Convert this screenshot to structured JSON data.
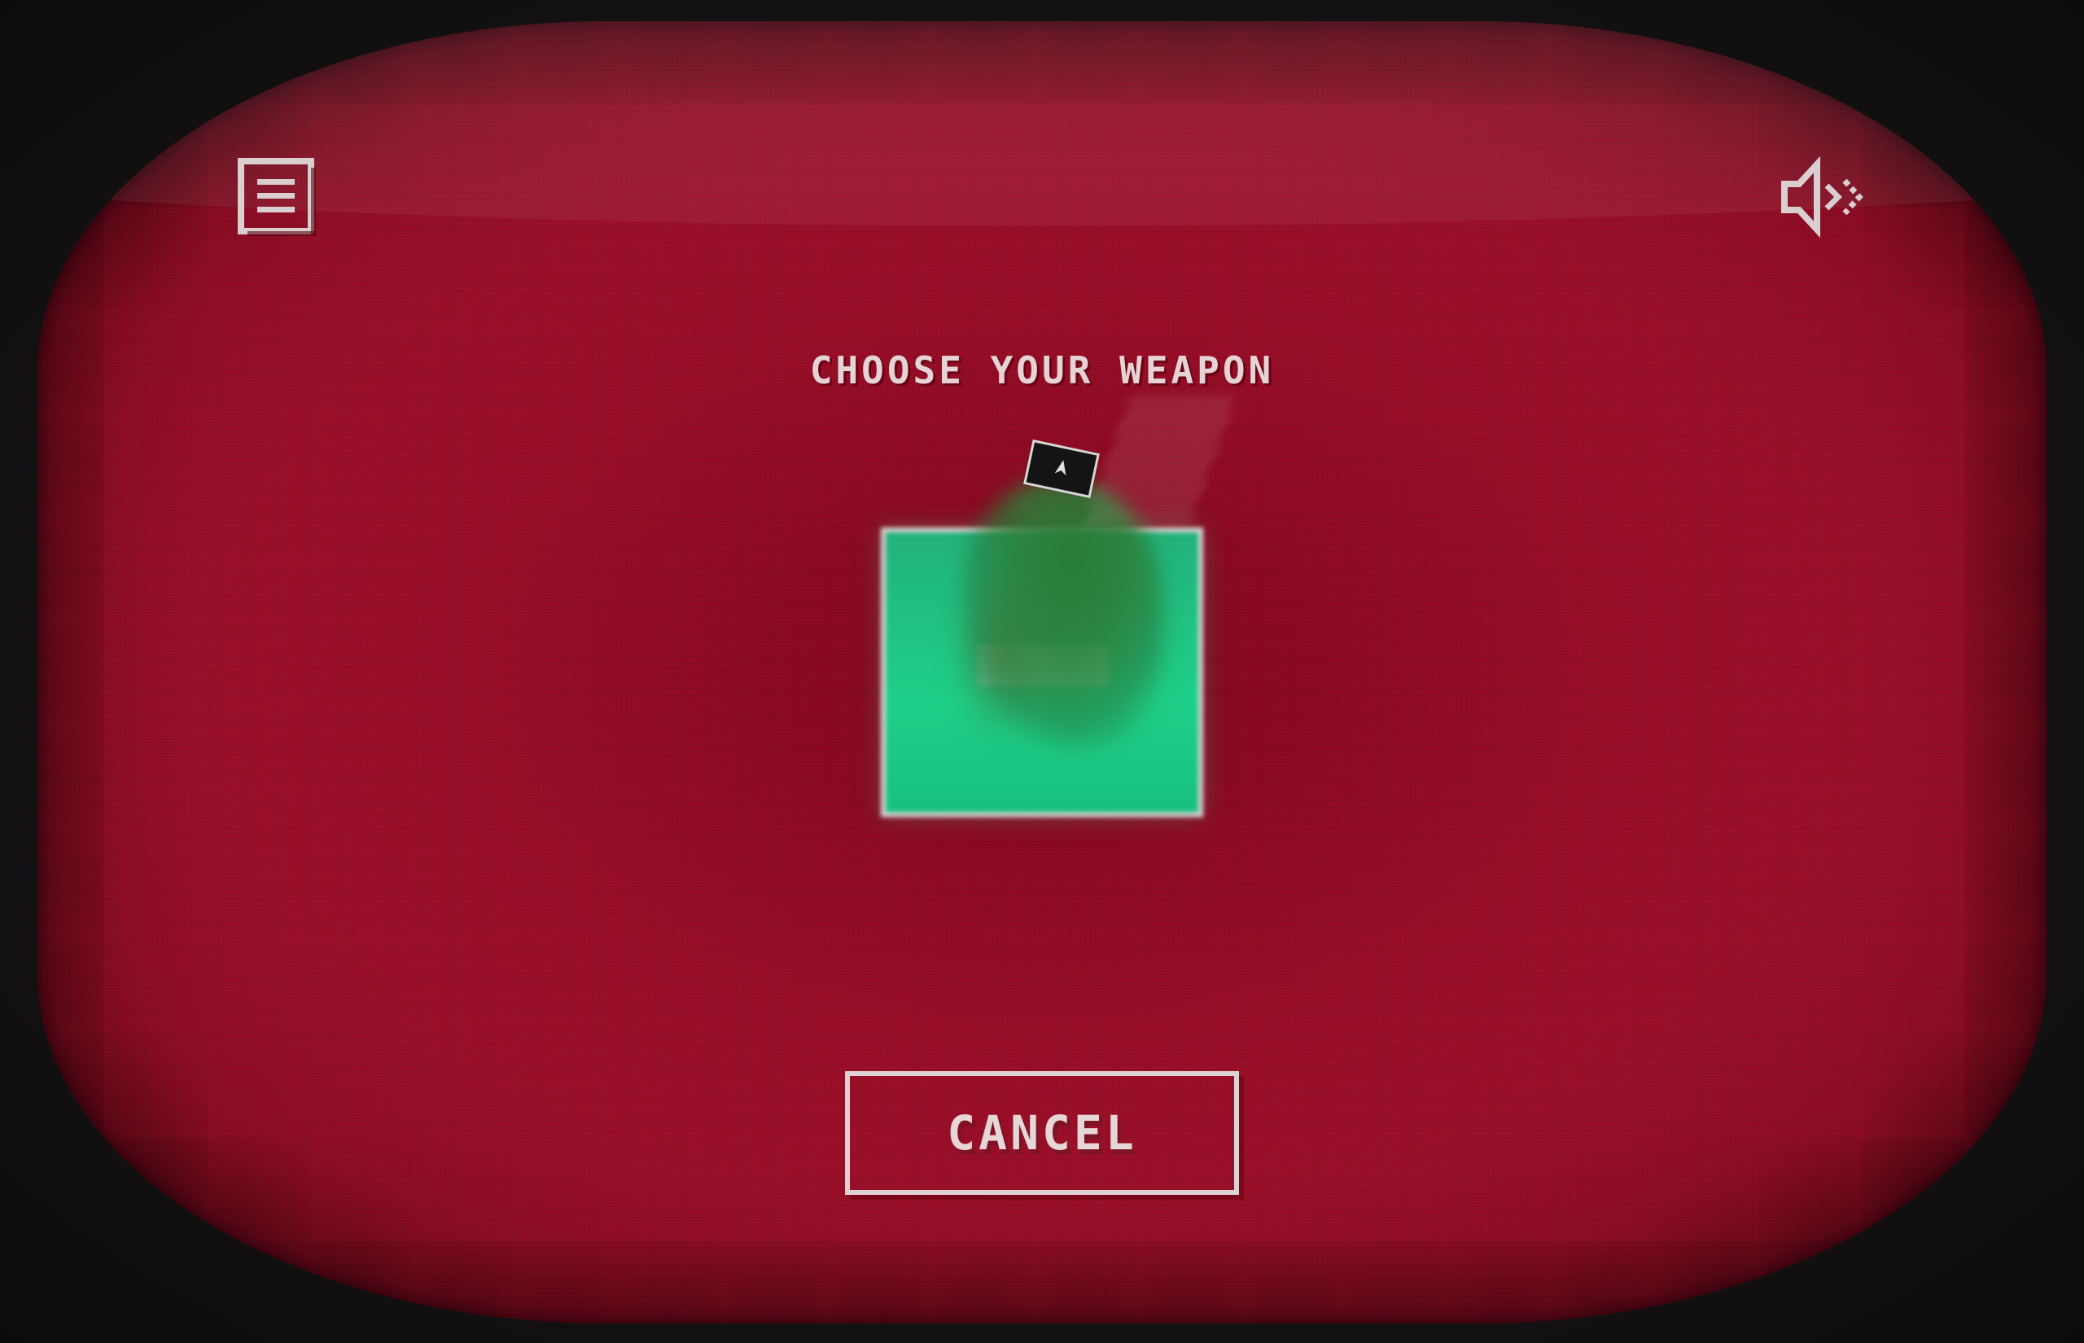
{
  "screen": {
    "title": "CHOOSE YOUR WEAPON",
    "background_color": "#a3112b",
    "bezel_color": "#141213"
  },
  "toolbar": {
    "menu_icon": "menu-list-icon",
    "sound_icon": "speaker-sound-icon"
  },
  "weapon_selector": {
    "card_color": "#1fcf88",
    "card_border_color": "#d9d3d3",
    "tag_icon": "weapon-tag-icon"
  },
  "actions": {
    "cancel_label": "CANCEL"
  }
}
